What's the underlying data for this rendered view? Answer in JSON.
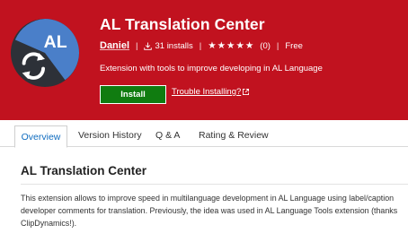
{
  "header": {
    "title": "AL Translation Center",
    "publisher": "Daniel",
    "installs": "31 installs",
    "rating_stars": "★★★★★",
    "rating_count": "(0)",
    "price": "Free",
    "description": "Extension with tools to improve developing in AL Language",
    "install_label": "Install",
    "trouble_label": "Trouble Installing?",
    "logo_text": "AL",
    "colors": {
      "banner": "#c1121f",
      "install": "#107c10",
      "logo_blue": "#4a7fc9",
      "logo_dark": "#2d3138"
    }
  },
  "tabs": [
    {
      "label": "Overview",
      "active": true
    },
    {
      "label": "Version History",
      "active": false
    },
    {
      "label": "Q & A",
      "active": false
    },
    {
      "label": "Rating & Review",
      "active": false
    }
  ],
  "main": {
    "heading": "AL Translation Center",
    "paragraph": "This extension allows to improve speed in multilanguage development in AL Language using label/caption developer comments for translation. Previously, the idea was used in AL Language Tools extension (thanks ClipDynamics!)."
  }
}
